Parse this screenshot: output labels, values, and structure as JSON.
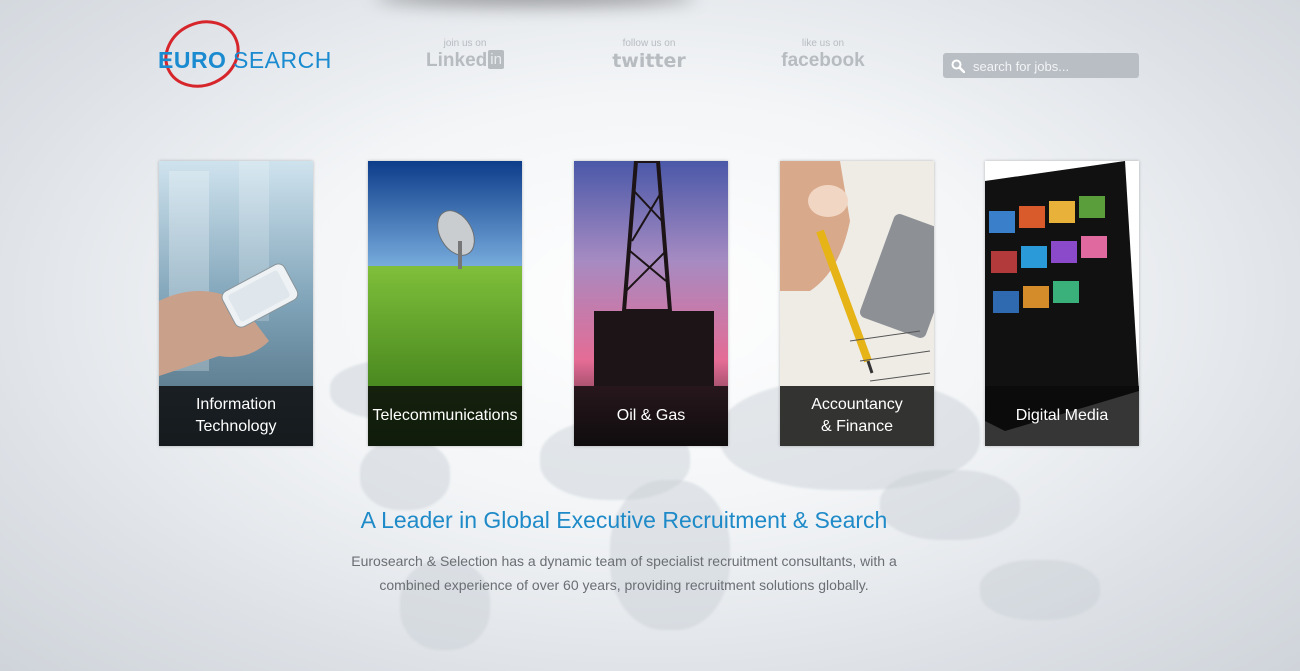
{
  "logo": {
    "part1": "EURO",
    "part2": "SEARCH",
    "ring_color": "#d6262b",
    "text_color": "#1a8bd0"
  },
  "social": [
    {
      "caption": "join us on",
      "brand": "Linked",
      "brand_badge": "in"
    },
    {
      "caption": "follow us on",
      "brand": "twitter"
    },
    {
      "caption": "like us on",
      "brand": "facebook"
    }
  ],
  "search": {
    "placeholder": "search for jobs..."
  },
  "sectors": [
    {
      "label": "Information\nTechnology"
    },
    {
      "label": "Telecommunications"
    },
    {
      "label": "Oil & Gas"
    },
    {
      "label": "Accountancy\n& Finance"
    },
    {
      "label": "Digital Media"
    }
  ],
  "headline": "A Leader in Global Executive Recruitment & Search",
  "intro": "Eurosearch & Selection has a dynamic team of specialist recruitment consultants, with a combined experience of over 60 years, providing recruitment solutions globally.",
  "colors": {
    "accent": "#1e8ac8",
    "label_bg": "#111111"
  }
}
